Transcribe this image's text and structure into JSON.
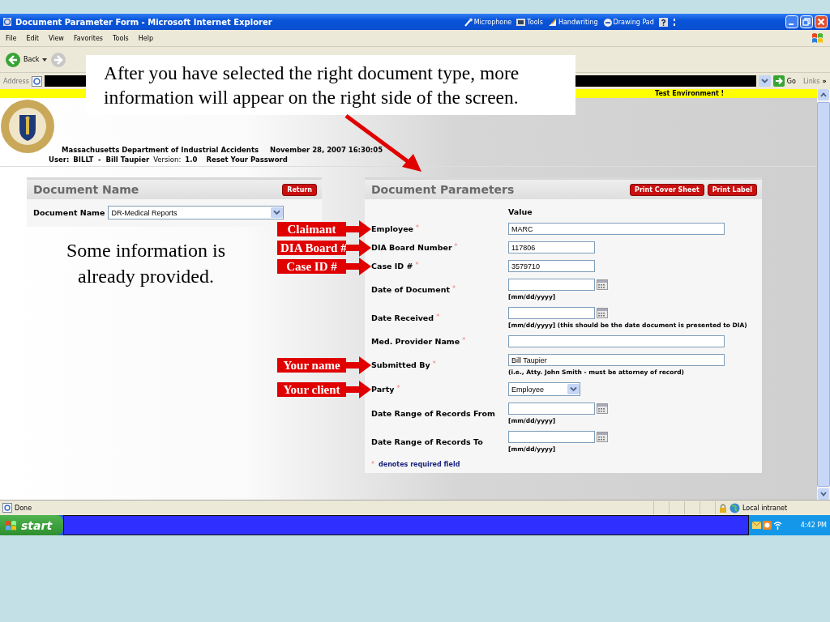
{
  "window": {
    "title": "Document Parameter Form - Microsoft Internet Explorer",
    "language_bar": [
      "Microphone",
      "Tools",
      "Handwriting",
      "Drawing Pad"
    ]
  },
  "menu": [
    "File",
    "Edit",
    "View",
    "Favorites",
    "Tools",
    "Help"
  ],
  "toolbar": {
    "back": "Back"
  },
  "address_bar": {
    "label": "Address",
    "go": "Go",
    "links": "Links",
    "more": "»"
  },
  "banner": "Test Environment !",
  "header": {
    "agency": "Massachusetts Department of Industrial Accidents",
    "timestamp": "November 28, 2007 16:30:05",
    "user_label": "User:",
    "user": "BILLT  -  Bill Taupier",
    "version_label": "Version:",
    "version": "1.0",
    "reset": "Reset Your Password"
  },
  "document_name_panel": {
    "title": "Document Name",
    "button": "Return",
    "field_label": "Document Name",
    "value": "DR-Medical Reports"
  },
  "parameters_panel": {
    "title": "Document Parameters",
    "buttons": [
      "Print Cover Sheet",
      "Print Label"
    ],
    "column_heading": "Value",
    "required_mark": "*",
    "fields": [
      {
        "kind": "wide",
        "label": "Employee",
        "required": true,
        "value": "MARC",
        "annotation": "Claimant"
      },
      {
        "kind": "short",
        "label": "DIA Board Number",
        "required": true,
        "value": "117806",
        "annotation": "DIA Board #"
      },
      {
        "kind": "short",
        "label": "Case ID #",
        "required": true,
        "value": "3579710",
        "annotation": "Case ID #"
      },
      {
        "kind": "date",
        "label": "Date of Document",
        "required": true,
        "hint": "[mm/dd/yyyy]"
      },
      {
        "kind": "date",
        "label": "Date Received",
        "required": true,
        "hint": "[mm/dd/yyyy] (this should be the date document is presented to DIA)"
      },
      {
        "kind": "wide",
        "label": "Med. Provider Name",
        "required": true
      },
      {
        "kind": "wide",
        "label": "Submitted By",
        "required": true,
        "value": "Bill Taupier",
        "hint": "(i.e., Atty. John Smith - must be attorney of record)",
        "annotation": "Your name"
      },
      {
        "kind": "select",
        "label": "Party",
        "required": true,
        "value": "Employee",
        "annotation": "Your client"
      },
      {
        "kind": "date",
        "label": "Date Range of Records From",
        "required": false,
        "hint": "[mm/dd/yyyy]"
      },
      {
        "kind": "date",
        "label": "Date Range of Records To",
        "required": false,
        "hint": "[mm/dd/yyyy]"
      }
    ],
    "footnote": "denotes required field"
  },
  "callout": "After you have selected the right document type, more information will appear on the right side of the screen.",
  "note": "Some information is already provided.",
  "status_bar": {
    "text": "Done",
    "zone": "Local intranet"
  },
  "taskbar": {
    "start": "start",
    "clock": "4:42 PM"
  }
}
